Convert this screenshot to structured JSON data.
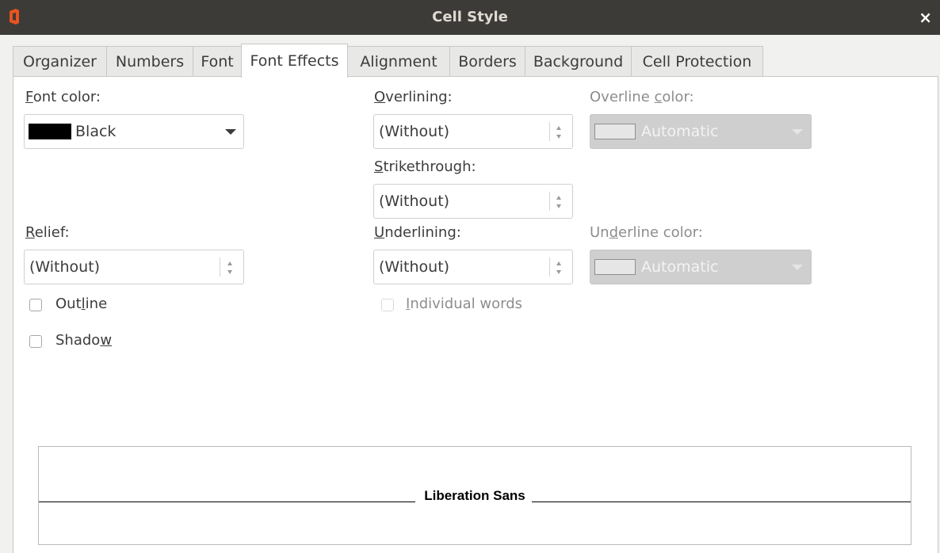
{
  "window": {
    "title": "Cell Style",
    "close_label": "×"
  },
  "tabs": [
    {
      "label": "Organizer"
    },
    {
      "label": "Numbers"
    },
    {
      "label": "Font"
    },
    {
      "label": "Font Effects",
      "active": true
    },
    {
      "label": "Alignment"
    },
    {
      "label": "Borders"
    },
    {
      "label": "Background"
    },
    {
      "label": "Cell Protection"
    }
  ],
  "font_color": {
    "label_ul": "F",
    "label_rest": "ont color:",
    "value": "Black",
    "swatch": "#000000"
  },
  "relief": {
    "label_ul": "R",
    "label_rest": "elief:",
    "value": "(Without)"
  },
  "outline": {
    "label_pre": "Out",
    "label_ul": "l",
    "label_post": "ine",
    "checked": false
  },
  "shadow": {
    "label_pre": "Shado",
    "label_ul": "w",
    "checked": false
  },
  "overlining": {
    "label_ul": "O",
    "label_rest": "verlining:",
    "value": "(Without)"
  },
  "overline_color": {
    "label_pre": "Overline ",
    "label_ul": "c",
    "label_post": "olor:",
    "value": "Automatic",
    "enabled": false
  },
  "strikethrough": {
    "label_ul": "S",
    "label_rest": "trikethrough:",
    "value": "(Without)"
  },
  "underlining": {
    "label_ul": "U",
    "label_rest": "nderlining:",
    "value": "(Without)"
  },
  "underline_color": {
    "label_pre": "Un",
    "label_ul": "d",
    "label_post": "erline color:",
    "value": "Automatic",
    "enabled": false
  },
  "individual_words": {
    "label_ul": "I",
    "label_rest": "ndividual words",
    "checked": false,
    "enabled": false
  },
  "preview": {
    "text": "Liberation Sans"
  },
  "colors": {
    "titlebar": "#3c3b37",
    "app_icon": "#e8531f",
    "disabled_combo": "#cfcfcf"
  }
}
